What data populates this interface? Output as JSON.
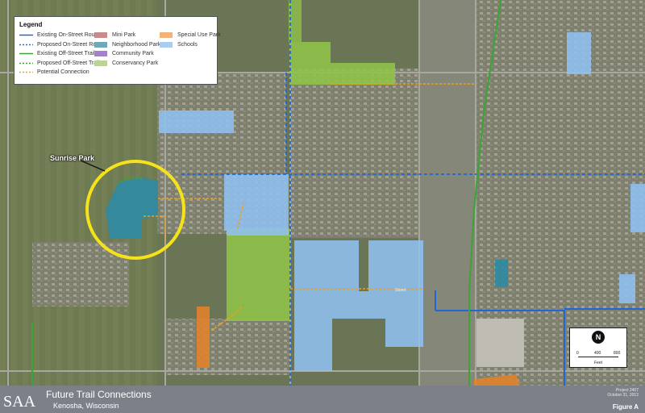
{
  "legend": {
    "title": "Legend",
    "items": [
      {
        "label": "Existing On-Street Route",
        "kind": "line",
        "color": "#1f66d6",
        "dash": "none"
      },
      {
        "label": "Proposed On-Street Route",
        "kind": "line",
        "color": "#1f66d6",
        "dash": "2,2"
      },
      {
        "label": "Existing Off-Street Trail",
        "kind": "line",
        "color": "#3fa33a",
        "dash": "none"
      },
      {
        "label": "Proposed Off-Street Trail",
        "kind": "line",
        "color": "#3fa33a",
        "dash": "2,2"
      },
      {
        "label": "Potential Connection",
        "kind": "line",
        "color": "#f0a019",
        "dash": "2,2"
      },
      {
        "label": "Mini Park",
        "kind": "swatch",
        "color": "#c98b8b"
      },
      {
        "label": "Neighborhood Park",
        "kind": "swatch",
        "color": "#6fa9b8"
      },
      {
        "label": "Community Park",
        "kind": "swatch",
        "color": "#a57fd0"
      },
      {
        "label": "Conservancy Park",
        "kind": "swatch",
        "color": "#b7d88a"
      },
      {
        "label": "Special Use Park",
        "kind": "swatch",
        "color": "#f2b27c"
      },
      {
        "label": "Schools",
        "kind": "swatch",
        "color": "#a9cdf1"
      }
    ]
  },
  "map": {
    "park_label": "Sunrise Park",
    "street_label": "Street"
  },
  "scale": {
    "north": "N",
    "ticks": [
      "0",
      "400",
      "800"
    ],
    "unit": "Feet"
  },
  "footer": {
    "logo": "SAA",
    "title": "Future Trail Connections",
    "subtitle": "Kenosha, Wisconsin",
    "project": "Project 2407",
    "date": "October 31, 2012",
    "figure": "Figure A"
  },
  "colors": {
    "route_blue": "#1f66d6",
    "trail_green": "#3fa33a",
    "connection_orange": "#f0a019",
    "school_blue": "#8fc0f0",
    "conservancy_green": "#8fc24a",
    "special_use_orange": "#e0822c",
    "neighborhood_teal": "#2f8aa2",
    "highlight_yellow": "#f5e21a"
  }
}
